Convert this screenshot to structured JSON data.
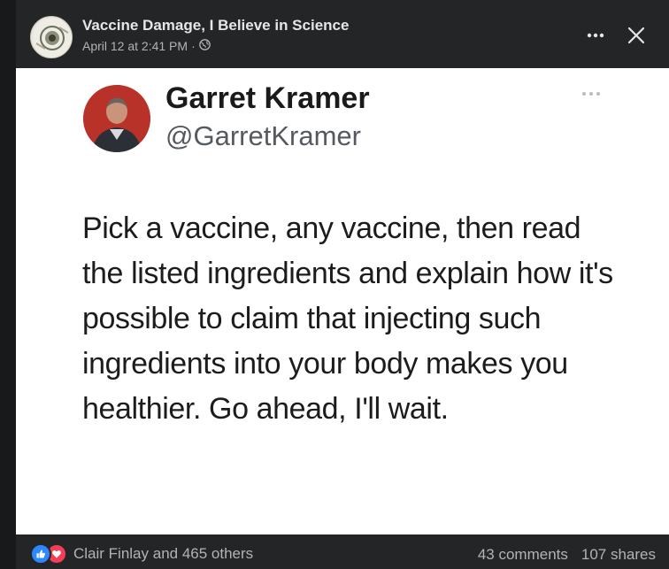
{
  "post": {
    "page_name": "Vaccine Damage, I Believe in Science",
    "timestamp": "April 12 at 2:41 PM",
    "separator": "·",
    "audience_icon": "globe-icon",
    "more_icon": "more-horizontal-icon",
    "close_icon": "close-icon"
  },
  "tweet": {
    "name": "Garret Kramer",
    "handle": "@GarretKramer",
    "text": "Pick a vaccine, any vaccine, then read the listed ingredients and explain how it's possible to claim that injecting such ingredients into your body makes you healthier. Go ahead, I'll wait."
  },
  "footer": {
    "reaction_icons": [
      "like-icon",
      "love-icon"
    ],
    "reaction_names": "Clair Finlay and 465 others",
    "comments": "43 comments",
    "shares": "107 shares"
  },
  "colors": {
    "header_bg": "#242526",
    "like": "#2d88ff",
    "love": "#f33e58",
    "secondary_text": "#b0b3b8",
    "primary_text": "#e4e6eb"
  }
}
